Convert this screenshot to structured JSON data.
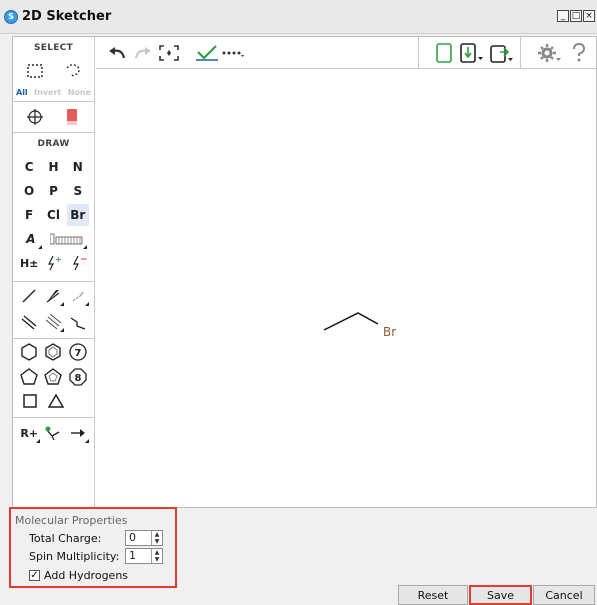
{
  "window": {
    "title": "2D Sketcher",
    "icon": "schrodinger-logo-icon",
    "controls": [
      "_",
      "□",
      "×"
    ]
  },
  "left_tools": {
    "select_header": "SELECT",
    "select_links": [
      "All",
      "Invert",
      "None"
    ],
    "draw_header": "DRAW",
    "element_rows": [
      [
        "C",
        "H",
        "N"
      ],
      [
        "O",
        "P",
        "S"
      ],
      [
        "F",
        "Cl",
        "Br"
      ]
    ],
    "selected_element": "Br",
    "misc_labels": {
      "atom_a": "A",
      "h_plusminus": "H±",
      "r_plus": "R+"
    }
  },
  "canvas": {
    "molecule_label": "Br"
  },
  "properties": {
    "title": "Molecular Properties",
    "total_charge_label": "Total Charge:",
    "total_charge_value": "0",
    "spin_label": "Spin Multiplicity:",
    "spin_value": "1",
    "add_h_label": "Add Hydrogens",
    "add_h_checked": true
  },
  "buttons": {
    "reset": "Reset",
    "save": "Save",
    "cancel": "Cancel"
  },
  "colors": {
    "highlight": "#e23b2f",
    "accent_green": "#2ea043",
    "bromine": "#8a5a2b"
  }
}
